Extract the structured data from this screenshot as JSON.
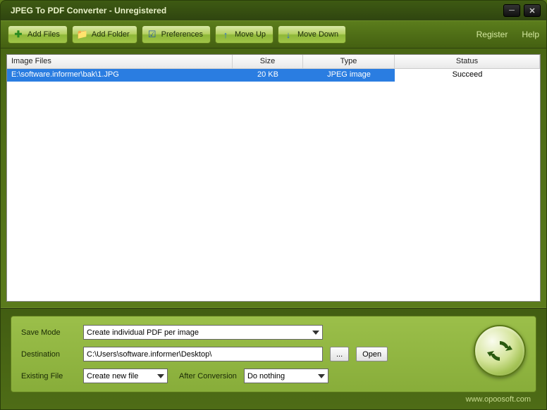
{
  "title": "JPEG To PDF Converter - Unregistered",
  "toolbar": {
    "add_files": "Add Files",
    "add_folder": "Add Folder",
    "preferences": "Preferences",
    "move_up": "Move Up",
    "move_down": "Move Down"
  },
  "links": {
    "register": "Register",
    "help": "Help"
  },
  "columns": {
    "file": "Image Files",
    "size": "Size",
    "type": "Type",
    "status": "Status"
  },
  "rows": [
    {
      "file": "E:\\software.informer\\bak\\1.JPG",
      "size": "20 KB",
      "type": "JPEG image",
      "status": "Succeed"
    }
  ],
  "settings": {
    "save_mode_label": "Save Mode",
    "save_mode_value": "Create individual PDF per image",
    "destination_label": "Destination",
    "destination_value": "C:\\Users\\software.informer\\Desktop\\",
    "browse": "...",
    "open": "Open",
    "existing_label": "Existing File",
    "existing_value": "Create new file",
    "after_label": "After Conversion",
    "after_value": "Do nothing"
  },
  "footer": "www.opoosoft.com"
}
